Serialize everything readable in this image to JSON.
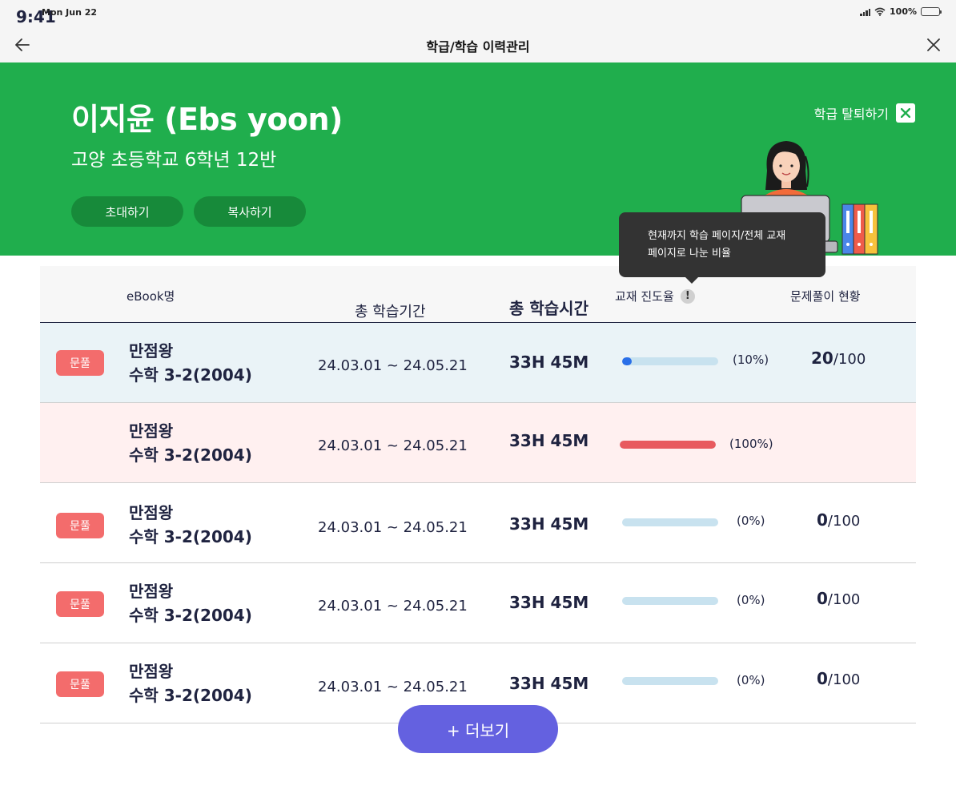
{
  "status_bar": {
    "time": "9:41",
    "date": "Mon Jun 22",
    "battery": "100%"
  },
  "header": {
    "title": "학급/학습 이력관리"
  },
  "profile": {
    "name": "이지윤 (Ebs yoon)",
    "school": "고양 초등학교 6학년 12반",
    "invite_label": "초대하기",
    "copy_label": "복사하기",
    "leave_label": "학급 탈퇴하기"
  },
  "tooltip": {
    "line1": "현재까지 학습 페이지/전체 교재",
    "line2": "페이지로 나눈 비율"
  },
  "table": {
    "headers": {
      "ebook": "eBook명",
      "period": "총 학습기간",
      "time": "총 학습시간",
      "progress": "교재 진도율",
      "quiz": "문제풀이 현황"
    },
    "rows": [
      {
        "badge": "문풀",
        "title1": "만점왕",
        "title2": "수학 3-2(2004)",
        "period": "24.03.01 ~ 24.05.21",
        "time": "33H 45M",
        "progress": 0.1,
        "pct": "(10%)",
        "score": "20",
        "total": "/100"
      },
      {
        "badge": "",
        "title1": "만점왕",
        "title2": "수학 3-2(2004)",
        "period": "24.03.01 ~ 24.05.21",
        "time": "33H 45M",
        "progress": 1.0,
        "pct": "(100%)",
        "score": "",
        "total": ""
      },
      {
        "badge": "문풀",
        "title1": "만점왕",
        "title2": "수학 3-2(2004)",
        "period": "24.03.01 ~ 24.05.21",
        "time": "33H 45M",
        "progress": 0,
        "pct": "(0%)",
        "score": "0",
        "total": "/100"
      },
      {
        "badge": "문풀",
        "title1": "만점왕",
        "title2": "수학 3-2(2004)",
        "period": "24.03.01 ~ 24.05.21",
        "time": "33H 45M",
        "progress": 0,
        "pct": "(0%)",
        "score": "0",
        "total": "/100"
      },
      {
        "badge": "문풀",
        "title1": "만점왕",
        "title2": "수학 3-2(2004)",
        "period": "24.03.01 ~ 24.05.21",
        "time": "33H 45M",
        "progress": 0,
        "pct": "(0%)",
        "score": "0",
        "total": "/100"
      }
    ]
  },
  "more_label": "+ 더보기",
  "colors": {
    "hero_green": "#20ae4d",
    "button_green": "#178a3a",
    "badge_red": "#f36c6c",
    "progress_blue": "#2a6fe8",
    "progress_red": "#e85a5e",
    "more_purple": "#6461e0"
  }
}
